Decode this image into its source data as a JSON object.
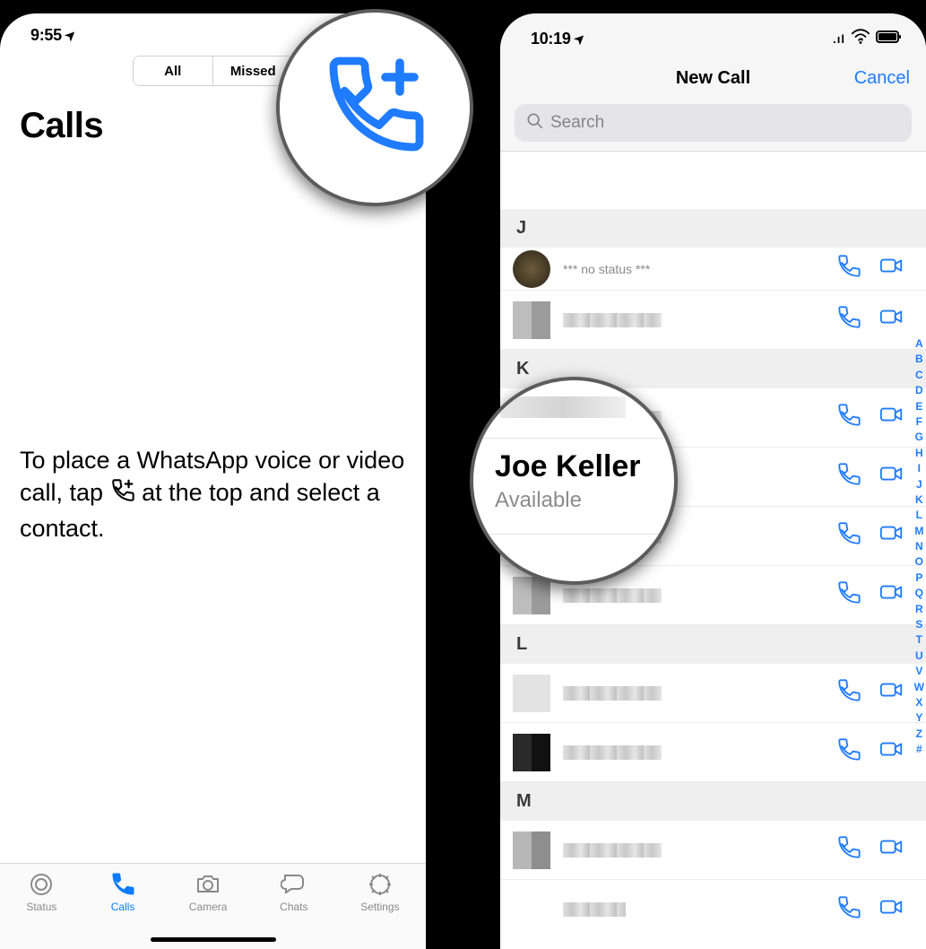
{
  "left": {
    "status_time": "9:55",
    "segmented": {
      "all": "All",
      "missed": "Missed"
    },
    "title": "Calls",
    "help_text_1": "To place a WhatsApp voice or video call, tap ",
    "help_text_2": " at the top and select a contact.",
    "tabs": {
      "status": "Status",
      "calls": "Calls",
      "camera": "Camera",
      "chats": "Chats",
      "settings": "Settings"
    }
  },
  "right": {
    "status_time": "10:19",
    "nav_title": "New Call",
    "cancel": "Cancel",
    "search_placeholder": "Search",
    "sections": {
      "j": "J",
      "k": "K",
      "l": "L",
      "m": "M"
    },
    "no_status": "*** no status ***",
    "index": [
      "A",
      "B",
      "C",
      "D",
      "E",
      "F",
      "G",
      "H",
      "I",
      "J",
      "K",
      "L",
      "M",
      "N",
      "O",
      "P",
      "Q",
      "R",
      "S",
      "T",
      "U",
      "V",
      "W",
      "X",
      "Y",
      "Z",
      "#"
    ]
  },
  "callout_contact": {
    "name": "Joe Keller",
    "status": "Available"
  },
  "colors": {
    "blue": "#1f7bff"
  }
}
